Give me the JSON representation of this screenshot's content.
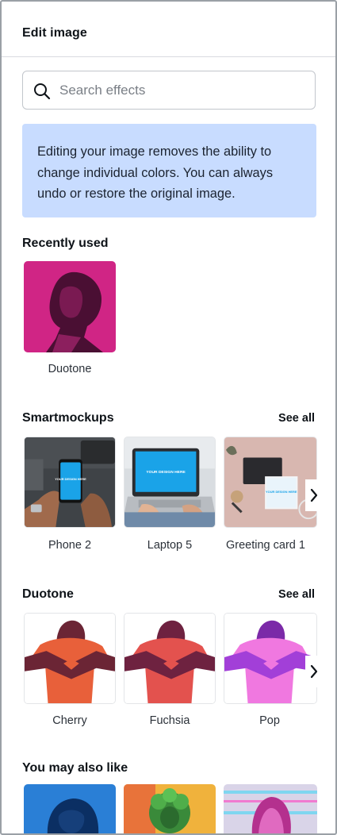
{
  "panel": {
    "title": "Edit image"
  },
  "search": {
    "placeholder": "Search effects",
    "icon": "search-icon"
  },
  "info_banner": {
    "text": "Editing your image removes the ability to change individual colors. You can always undo or restore the original image."
  },
  "recently_used": {
    "title": "Recently used",
    "items": [
      {
        "label": "Duotone"
      }
    ]
  },
  "smartmockups": {
    "title": "Smartmockups",
    "see_all": "See all",
    "items": [
      {
        "label": "Phone 2",
        "screen_text": "YOUR DESIGN HERE"
      },
      {
        "label": "Laptop 5",
        "screen_text": "YOUR DESIGN HERE"
      },
      {
        "label": "Greeting card 1",
        "screen_text": "YOUR DESIGN HERE"
      }
    ]
  },
  "duotone": {
    "title": "Duotone",
    "see_all": "See all",
    "items": [
      {
        "label": "Cherry"
      },
      {
        "label": "Fuchsia"
      },
      {
        "label": "Pop"
      }
    ]
  },
  "you_may_also_like": {
    "title": "You may also like"
  },
  "colors": {
    "info_bg": "#c8dcff",
    "duotone_magenta": "#d8288a",
    "cherry_orange": "#e8603a",
    "cherry_dark": "#6b2535",
    "pop_purple": "#a23fd8",
    "pop_pink": "#f078e0"
  }
}
